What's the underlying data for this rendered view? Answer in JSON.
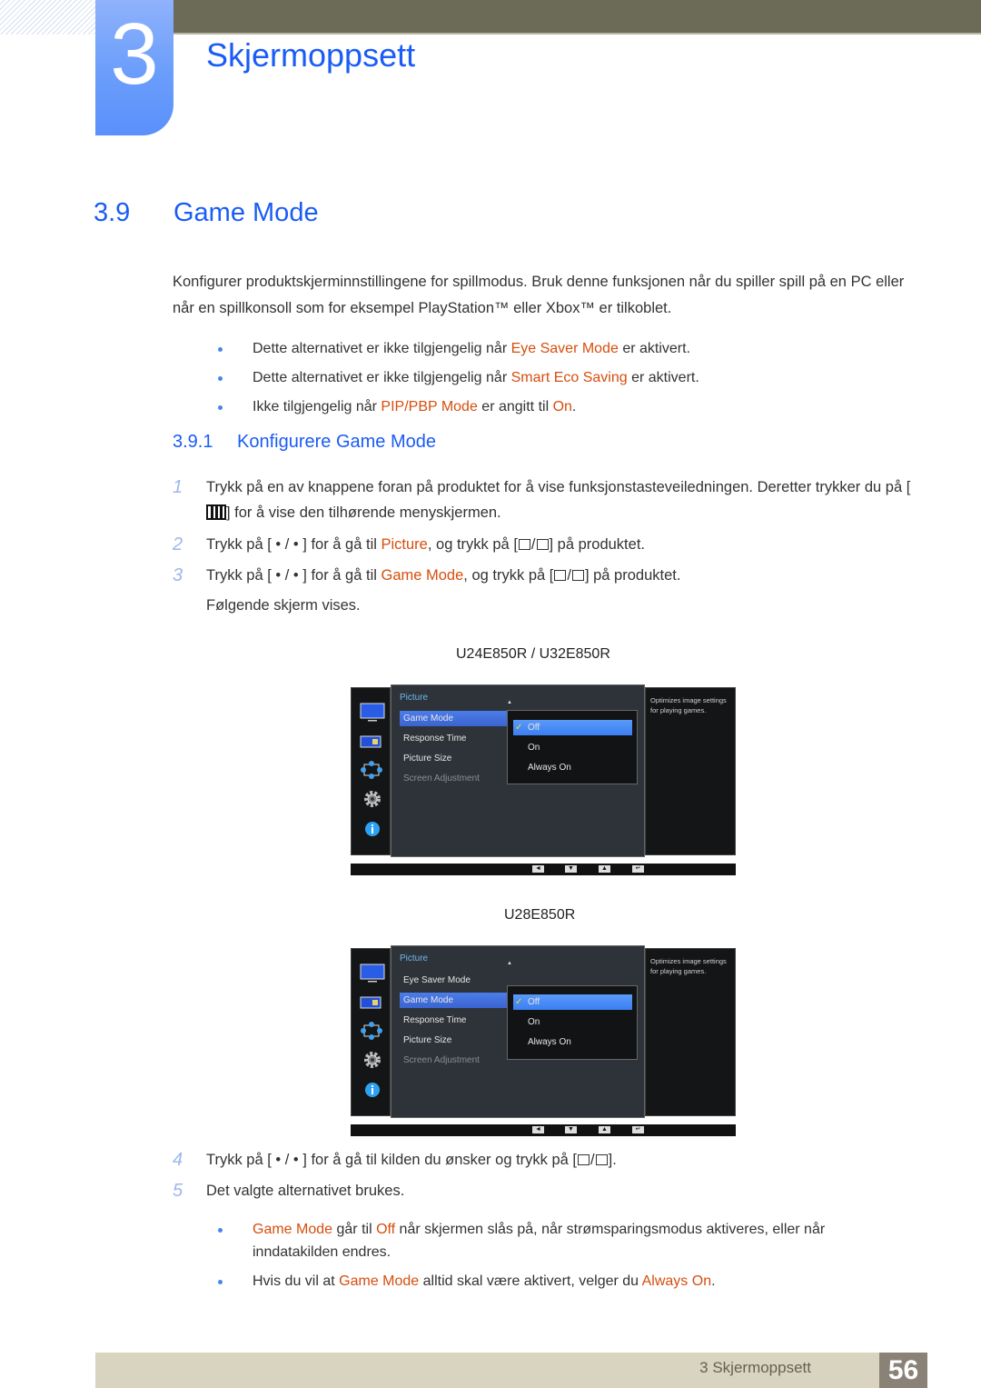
{
  "header": {
    "chapter_number": "3",
    "chapter_title": "Skjermoppsett"
  },
  "section": {
    "number": "3.9",
    "title": "Game Mode",
    "intro": "Konfigurer produktskjerminnstillingene for spillmodus. Bruk denne funksjonen når du spiller spill på en PC eller når en spillkonsoll som for eksempel PlayStation™ eller Xbox™ er tilkoblet.",
    "notes": [
      {
        "pre": "Dette alternativet er ikke tilgjengelig når ",
        "hl": "Eye Saver Mode",
        "post": " er aktivert."
      },
      {
        "pre": "Dette alternativet er ikke tilgjengelig når ",
        "hl": "Smart Eco Saving",
        "post": " er aktivert."
      },
      {
        "pre": "Ikke tilgjengelig når ",
        "hl": "PIP/PBP Mode",
        "mid": " er angitt til ",
        "hl2": "On",
        "post": "."
      }
    ]
  },
  "subsection": {
    "number": "3.9.1",
    "title": "Konfigurere Game Mode"
  },
  "steps": [
    {
      "n": "1",
      "a": "Trykk på en av knappene foran på produktet for å vise funksjonstasteveiledningen. Deretter trykker du på [",
      "b": "] for å vise den tilhørende menyskjermen."
    },
    {
      "n": "2",
      "a": "Trykk på [ • / • ] for å gå til ",
      "hl": "Picture",
      "b": ", og trykk på [",
      "c": "] på produktet."
    },
    {
      "n": "3",
      "a": "Trykk på [ • / • ] for å gå til ",
      "hl": "Game Mode",
      "b": ", og trykk på [",
      "c": "] på produktet.",
      "extra": "Følgende skjerm vises."
    },
    {
      "n": "4",
      "a": "Trykk på [ • / • ] for å gå til kilden du ønsker og trykk på [",
      "c": "]."
    },
    {
      "n": "5",
      "a": "Det valgte alternativet brukes."
    }
  ],
  "osd_screens": [
    {
      "model": "U24E850R / U32E850R",
      "menu_title": "Picture",
      "items": [
        "Game Mode",
        "Response Time",
        "Picture Size",
        "Screen Adjustment"
      ],
      "selected_item": "Game Mode",
      "options": [
        "Off",
        "On",
        "Always On"
      ],
      "selected_option": "Off",
      "description": "Optimizes image settings for playing games."
    },
    {
      "model": "U28E850R",
      "menu_title": "Picture",
      "items": [
        "Eye Saver Mode",
        "Game Mode",
        "Response Time",
        "Picture Size",
        "Screen Adjustment"
      ],
      "selected_item": "Game Mode",
      "options": [
        "Off",
        "On",
        "Always On"
      ],
      "selected_option": "Off",
      "description": "Optimizes image settings for playing games."
    }
  ],
  "osd_icons": [
    "picture-icon",
    "color-icon",
    "size-position-icon",
    "setup-icon",
    "information-icon"
  ],
  "osd_buttons": [
    "◄",
    "▼",
    "▲",
    "↵"
  ],
  "final_notes": [
    {
      "hl": "Game Mode",
      "a": " går til ",
      "hl2": "Off",
      "b": " når skjermen slås på, når strømsparingsmodus aktiveres, eller når inndatakilden endres."
    },
    {
      "a": "Hvis du vil at ",
      "hl": "Game Mode",
      "b": " alltid skal være aktivert, velger du ",
      "hl2": "Always On",
      "c": "."
    }
  ],
  "footer": {
    "chapter_label": "3 Skjermoppsett",
    "page_number": "56"
  },
  "colors": {
    "accent_blue": "#1a5cf5",
    "highlight_orange": "#d64e0e",
    "top_bar": "#6c6b57"
  }
}
